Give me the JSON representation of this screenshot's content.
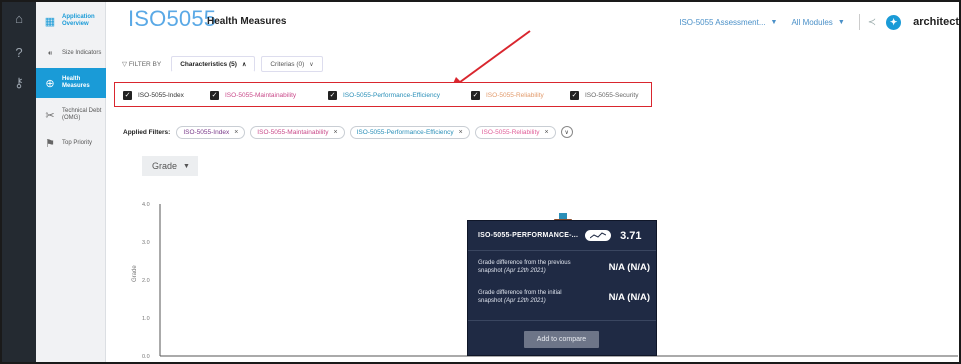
{
  "header": {
    "title": "ISO5055",
    "subtitle": "Health Measures",
    "assessment_select": "ISO-5055 Assessment...",
    "modules_select": "All Modules",
    "brand": "architect"
  },
  "sidebar": {
    "items": [
      {
        "label": "Application Overview"
      },
      {
        "label": "Size Indicators"
      },
      {
        "label": "Health Measures"
      },
      {
        "label": "Technical Debt (OMG)"
      },
      {
        "label": "Top Priority"
      }
    ]
  },
  "filter": {
    "label": "FILTER BY",
    "tabs": [
      {
        "label": "Characteristics (5)"
      },
      {
        "label": "Criterias (0)"
      }
    ],
    "characteristics": [
      {
        "label": "ISO-5055-Index",
        "color": "#333333"
      },
      {
        "label": "ISO-5055-Maintainability",
        "color": "#c94a8a"
      },
      {
        "label": "ISO-5055-Performance-Efficiency",
        "color": "#2a8fb8"
      },
      {
        "label": "ISO-5055-Reliability",
        "color": "#e29a6b"
      },
      {
        "label": "ISO-5055-Security",
        "color": "#666666"
      }
    ]
  },
  "applied_filters": {
    "label": "Applied Filters:",
    "chips": [
      {
        "label": "ISO-5055-Index",
        "color": "#7a3a8a"
      },
      {
        "label": "ISO-5055-Maintainability",
        "color": "#c94a8a"
      },
      {
        "label": "ISO-5055-Performance-Efficiency",
        "color": "#2a8fb8"
      },
      {
        "label": "ISO-5055-Reliability",
        "color": "#e0609a"
      }
    ]
  },
  "grade_select": "Grade",
  "chart_data": {
    "type": "scatter",
    "ylabel": "Grade",
    "xlabel": "",
    "ylim": [
      0,
      4
    ],
    "y_ticks": [
      "4.0",
      "3.0",
      "2.0",
      "1.0",
      "0.0"
    ],
    "series": [
      {
        "name": "ISO-5055-Performance-Efficiency",
        "x": [
          "Apr 12th 2021"
        ],
        "values": [
          3.71
        ],
        "color": "#8a4a2a"
      }
    ]
  },
  "tooltip": {
    "name": "ISO-5055-PERFORMANCE-...",
    "value": "3.71",
    "rows": [
      {
        "text": "Grade difference from the previous snapshot",
        "date": "(Apr 12th 2021)",
        "value": "N/A (N/A)"
      },
      {
        "text": "Grade difference from the initial snapshot",
        "date": "(Apr 12th 2021)",
        "value": "N/A (N/A)"
      }
    ],
    "compare_label": "Add to compare"
  },
  "colors": {
    "accent": "#1a9bd7",
    "highlight_border": "#d9262e",
    "tooltip_bg": "#1f2a44"
  }
}
